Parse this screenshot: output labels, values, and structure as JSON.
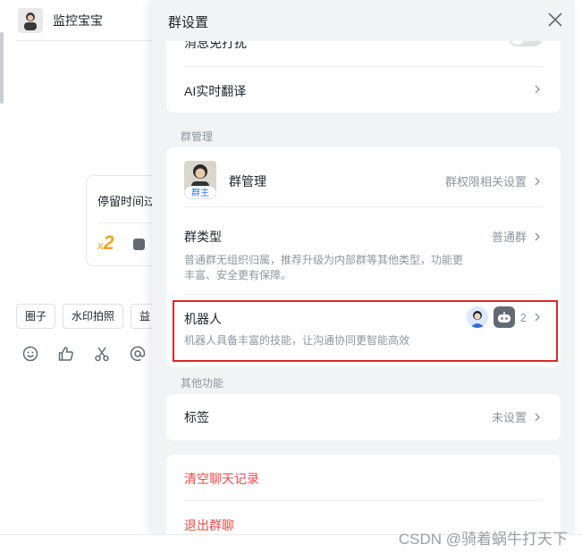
{
  "chat": {
    "name": "监控宝宝",
    "card_text": "停留时间过",
    "card_multiplier_prefix": "x",
    "card_multiplier": "2",
    "chips": [
      "圈子",
      "水印拍照",
      "益"
    ]
  },
  "panel": {
    "title": "群设置",
    "mute_label": "消息免打扰",
    "ai_translate_label": "AI实时翻译",
    "section_manage": "群管理",
    "group_manage_label": "群管理",
    "owner_tag": "群主",
    "group_manage_value": "群权限相关设置",
    "group_type_label": "群类型",
    "group_type_value": "普通群",
    "group_type_desc_1": "普通群无组织归属，推荐升级为内部群等其他类型，功能更",
    "group_type_desc_2": "丰富、安全更有保障。",
    "robot_label": "机器人",
    "robot_count": "2",
    "robot_desc": "机器人具备丰富的技能，让沟通协同更智能高效",
    "section_other": "其他功能",
    "tag_label": "标签",
    "tag_value": "未设置",
    "clear_history": "清空聊天记录",
    "exit_group": "退出群聊"
  },
  "watermark": "CSDN @骑着蜗牛打天下",
  "colors": {
    "panel_bg": "#f2f3f5",
    "danger": "#f54a45",
    "highlight_border": "#d9262e",
    "accent": "#f5a623"
  }
}
